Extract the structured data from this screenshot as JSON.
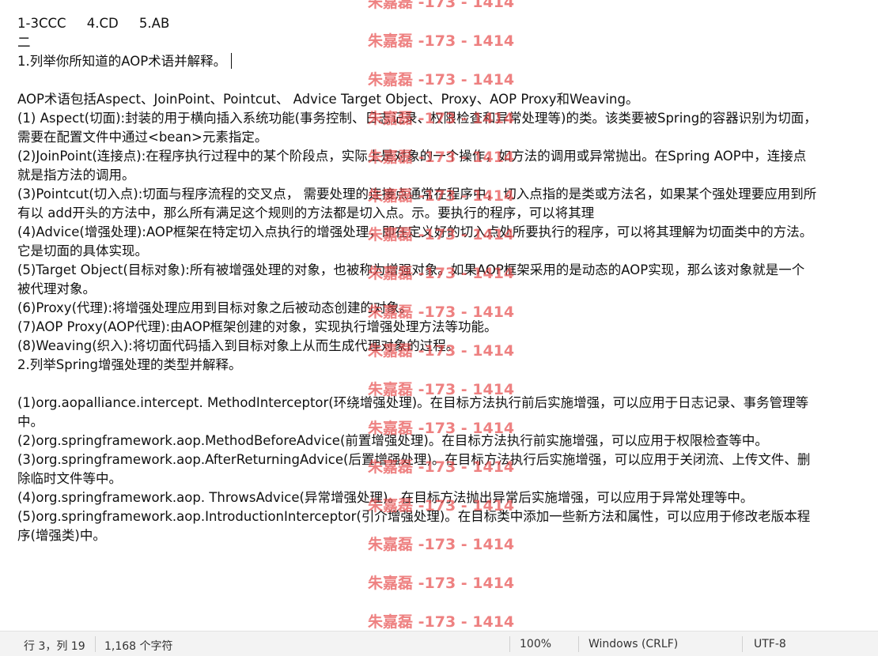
{
  "editor": {
    "lines": [
      "1-3CCC     4.CD     5.AB",
      "二",
      "1.列举你所知道的AOP术语并解释。",
      "",
      "AOP术语包括Aspect、JoinPoint、Pointcut、 Advice Target Object、Proxy、AOP Proxy和Weaving。",
      "(1) Aspect(切面):封装的用于横向插入系统功能(事务控制、日志记录、权限检查和异常处理等)的类。该类要被Spring的容器识别为切面，",
      "需要在配置文件中通过<bean>元素指定。",
      "(2)JoinPoint(连接点):在程序执行过程中的某个阶段点，实际上是对象的一个操作，如方法的调用或异常抛出。在Spring AOP中，连接点",
      "就是指方法的调用。",
      "(3)Pointcut(切入点):切面与程序流程的交叉点， 需要处理的连接点通常在程序中， 切入点指的是类或方法名，如果某个强处理要应用到所",
      "有以 add开头的方法中，那么所有满足这个规则的方法都是切入点。示。要执行的程序，可以将其理",
      "(4)Advice(增强处理):AOP框架在特定切入点执行的增强处理，即在定义好的切入点处所要执行的程序，可以将其理解为切面类中的方法。",
      "它是切面的具体实现。",
      "(5)Target Object(目标对象):所有被增强处理的对象，也被称为增强对象。如果AOP框架采用的是动态的AOP实现，那么该对象就是一个",
      "被代理对象。",
      "(6)Proxy(代理):将增强处理应用到目标对象之后被动态创建的对象。",
      "(7)AOP Proxy(AOP代理):由AOP框架创建的对象，实现执行增强处理方法等功能。",
      "(8)Weaving(织入):将切面代码插入到目标对象上从而生成代理对象的过程。",
      "2.列举Spring增强处理的类型并解释。",
      "",
      "(1)org.aopalliance.intercept. MethodInterceptor(环绕增强处理)。在目标方法执行前后实施增强，可以应用于日志记录、事务管理等",
      "中。",
      "(2)org.springframework.aop.MethodBeforeAdvice(前置增强处理)。在目标方法执行前实施增强，可以应用于权限检查等中。",
      "(3)org.springframework.aop.AfterReturningAdvice(后置增强处理)。在目标方法执行后实施增强，可以应用于关闭流、上传文件、删",
      "除临时文件等中。",
      "(4)org.springframework.aop. ThrowsAdvice(异常增强处理)。在目标方法抛出异常后实施增强，可以应用于异常处理等中。",
      "(5)org.springframework.aop.IntroductionInterceptor(引介增强处理)。在目标类中添加一些新方法和属性，可以应用于修改老版本程",
      "序(增强类)中。"
    ]
  },
  "watermarks": [
    "朱嘉磊 -173 - 1414",
    "朱嘉磊 -173 - 1414",
    "朱嘉磊 -173 - 1414",
    "朱嘉磊 -173 - 1414",
    "朱嘉磊 -173 - 1414",
    "朱嘉磊 -173 - 1414",
    "朱嘉磊 -173 - 1414",
    "朱嘉磊 -173 - 1414",
    "朱嘉磊 -173 - 1414",
    "朱嘉磊 -173 - 1414",
    "朱嘉磊 -173 - 1414",
    "朱嘉磊 -173 - 1414",
    "朱嘉磊 -173 - 1414",
    "朱嘉磊 -173 - 1414",
    "朱嘉磊 -173 - 1414",
    "朱嘉磊 -173 - 1414",
    "朱嘉磊 -173 - 1414"
  ],
  "statusbar": {
    "position": "行 3，列 19",
    "char_count": "1,168 个字符",
    "zoom": "100%",
    "line_ending": "Windows (CRLF)",
    "encoding": "UTF-8"
  }
}
